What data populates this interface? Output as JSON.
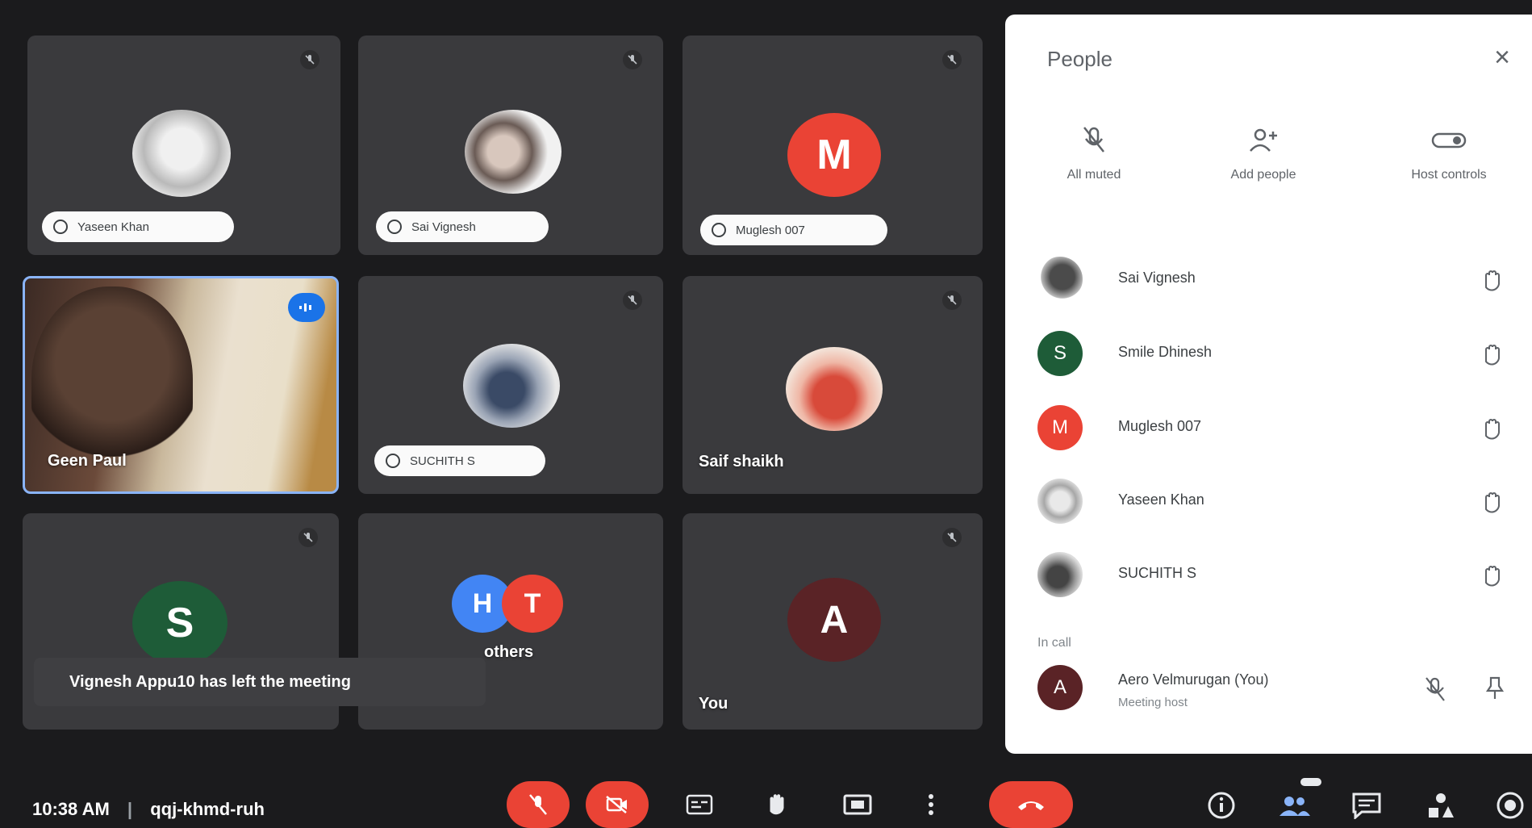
{
  "tiles": {
    "yaseen": {
      "name": "Yaseen Khan"
    },
    "sai": {
      "name": "Sai Vignesh"
    },
    "muglesh": {
      "name": "Muglesh 007",
      "initial": "M"
    },
    "speaker": {
      "name": "Geen Paul"
    },
    "suchith": {
      "name": "SUCHITH S"
    },
    "saif": {
      "name": "Saif shaikh"
    },
    "s": {
      "initial": "S"
    },
    "others": {
      "initial1": "H",
      "initial2": "T",
      "label": "others"
    },
    "you": {
      "initial": "A",
      "label": "You"
    }
  },
  "toast": {
    "text": "Vignesh Appu10 has left the meeting"
  },
  "panel": {
    "title": "People",
    "close": "×",
    "controls": [
      {
        "label": "All muted",
        "icon": "mic-off-icon"
      },
      {
        "label": "Add people",
        "icon": "add-person-icon"
      },
      {
        "label": "Host controls",
        "icon": "toggle-icon"
      }
    ],
    "participants": [
      {
        "name": "Sai Vignesh",
        "initial": ""
      },
      {
        "name": "Smile Dhinesh",
        "initial": "S"
      },
      {
        "name": "Muglesh 007",
        "initial": "M"
      },
      {
        "name": "Yaseen Khan",
        "initial": ""
      },
      {
        "name": "SUCHITH S",
        "initial": ""
      }
    ],
    "in_call_label": "In call",
    "in_call": [
      {
        "name": "Aero Velmurugan (You)",
        "sub": "Meeting host",
        "initial": "A"
      }
    ]
  },
  "bottom": {
    "time": "10:38 AM",
    "separator": "|",
    "meeting_code": "qqj-khmd-ruh"
  },
  "colors": {
    "red": "#ea4335",
    "green": "#1e5c38",
    "blue": "#4285f4",
    "dark_red_avatar": "#5a2326",
    "accent_blue": "#8ab4f8"
  }
}
